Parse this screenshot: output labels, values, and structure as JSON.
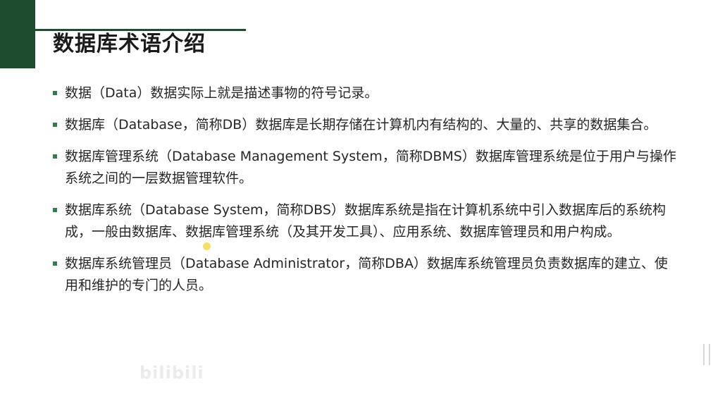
{
  "slide": {
    "title": "数据库术语介绍",
    "colors": {
      "accent": "#1e4c2f",
      "bullet": "#2f7d4a",
      "text": "#262626"
    },
    "bullets": [
      {
        "text": "数据（Data）数据实际上就是描述事物的符号记录。"
      },
      {
        "text": "数据库（Database，简称DB）数据库是长期存储在计算机内有结构的、大量的、共享的数据集合。"
      },
      {
        "text": "数据库管理系统（Database Management System，简称DBMS）数据库管理系统是位于用户与操作系统之间的一层数据管理软件。"
      },
      {
        "text": "数据库系统（Database System，简称DBS）数据库系统是指在计算机系统中引入数据库后的系统构成，一般由数据库、数据库管理系统（及其开发工具）、应用系统、数据库管理员和用户构成。"
      },
      {
        "text": "数据库系统管理员（Database Administrator，简称DBA）数据库系统管理员负责数据库的建立、使用和维护的专门的人员。"
      }
    ]
  },
  "watermark": {
    "logo_text": "bilibili"
  }
}
